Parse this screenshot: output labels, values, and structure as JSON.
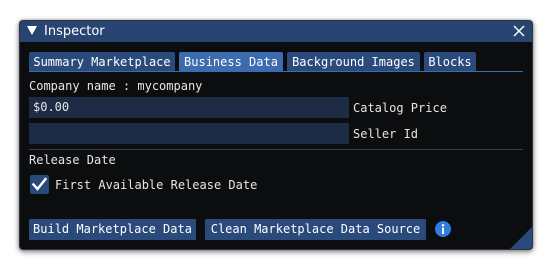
{
  "window": {
    "title": "Inspector",
    "close_icon": "close-icon",
    "collapse_icon": "triangle-down-icon"
  },
  "tabs": [
    {
      "label": "Summary Marketplace",
      "active": false
    },
    {
      "label": "Business Data",
      "active": true
    },
    {
      "label": "Background Images",
      "active": false
    },
    {
      "label": "Blocks",
      "active": false
    }
  ],
  "company": {
    "label": "Company name : mycompany"
  },
  "fields": {
    "catalog_price": {
      "value": "$0.00",
      "label": "Catalog Price"
    },
    "seller_id": {
      "value": "",
      "label": "Seller Id"
    }
  },
  "release": {
    "heading": "Release Date",
    "checkbox_label": "First Available Release Date",
    "checked": true
  },
  "buttons": {
    "build": "Build Marketplace Data",
    "clean": "Clean Marketplace Data Source"
  },
  "colors": {
    "titlebar": "#284572",
    "tab": "#2a4a7c",
    "tab_active": "#3d6bb0",
    "field": "#1d2b44",
    "background": "#0c0d0f",
    "check": "#ffffff",
    "info": "#2f7de1"
  }
}
